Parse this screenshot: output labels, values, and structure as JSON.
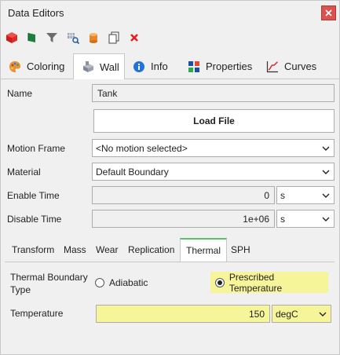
{
  "window": {
    "title": "Data Editors"
  },
  "toolbar": {
    "items": [
      "red-cube-icon",
      "green-flag-icon",
      "filter-icon",
      "search-grid-icon",
      "orange-cylinder-icon",
      "copy-icon",
      "delete-icon"
    ]
  },
  "tabs": [
    {
      "label": "Coloring",
      "icon": "palette-icon"
    },
    {
      "label": "Wall",
      "icon": "wall-icon"
    },
    {
      "label": "Info",
      "icon": "info-icon"
    },
    {
      "label": "Properties",
      "icon": "properties-icon"
    },
    {
      "label": "Curves",
      "icon": "curves-icon"
    }
  ],
  "form": {
    "name_label": "Name",
    "name_value": "Tank",
    "load_file": "Load File",
    "motion_label": "Motion Frame",
    "motion_value": "<No motion selected>",
    "material_label": "Material",
    "material_value": "Default Boundary",
    "enable_label": "Enable Time",
    "enable_value": "0",
    "enable_unit": "s",
    "disable_label": "Disable Time",
    "disable_value": "1e+06",
    "disable_unit": "s"
  },
  "subtabs": [
    "Transform",
    "Mass",
    "Wear",
    "Replication",
    "Thermal",
    "SPH"
  ],
  "thermal": {
    "boundary_label_1": "Thermal Boundary",
    "boundary_label_2": "Type",
    "adiabatic": "Adiabatic",
    "prescribed": "Prescribed Temperature",
    "temp_label": "Temperature",
    "temp_value": "150",
    "temp_unit": "degC"
  },
  "colors": {
    "highlight": "#f6f59a",
    "active_subtab": "#59c16a"
  }
}
